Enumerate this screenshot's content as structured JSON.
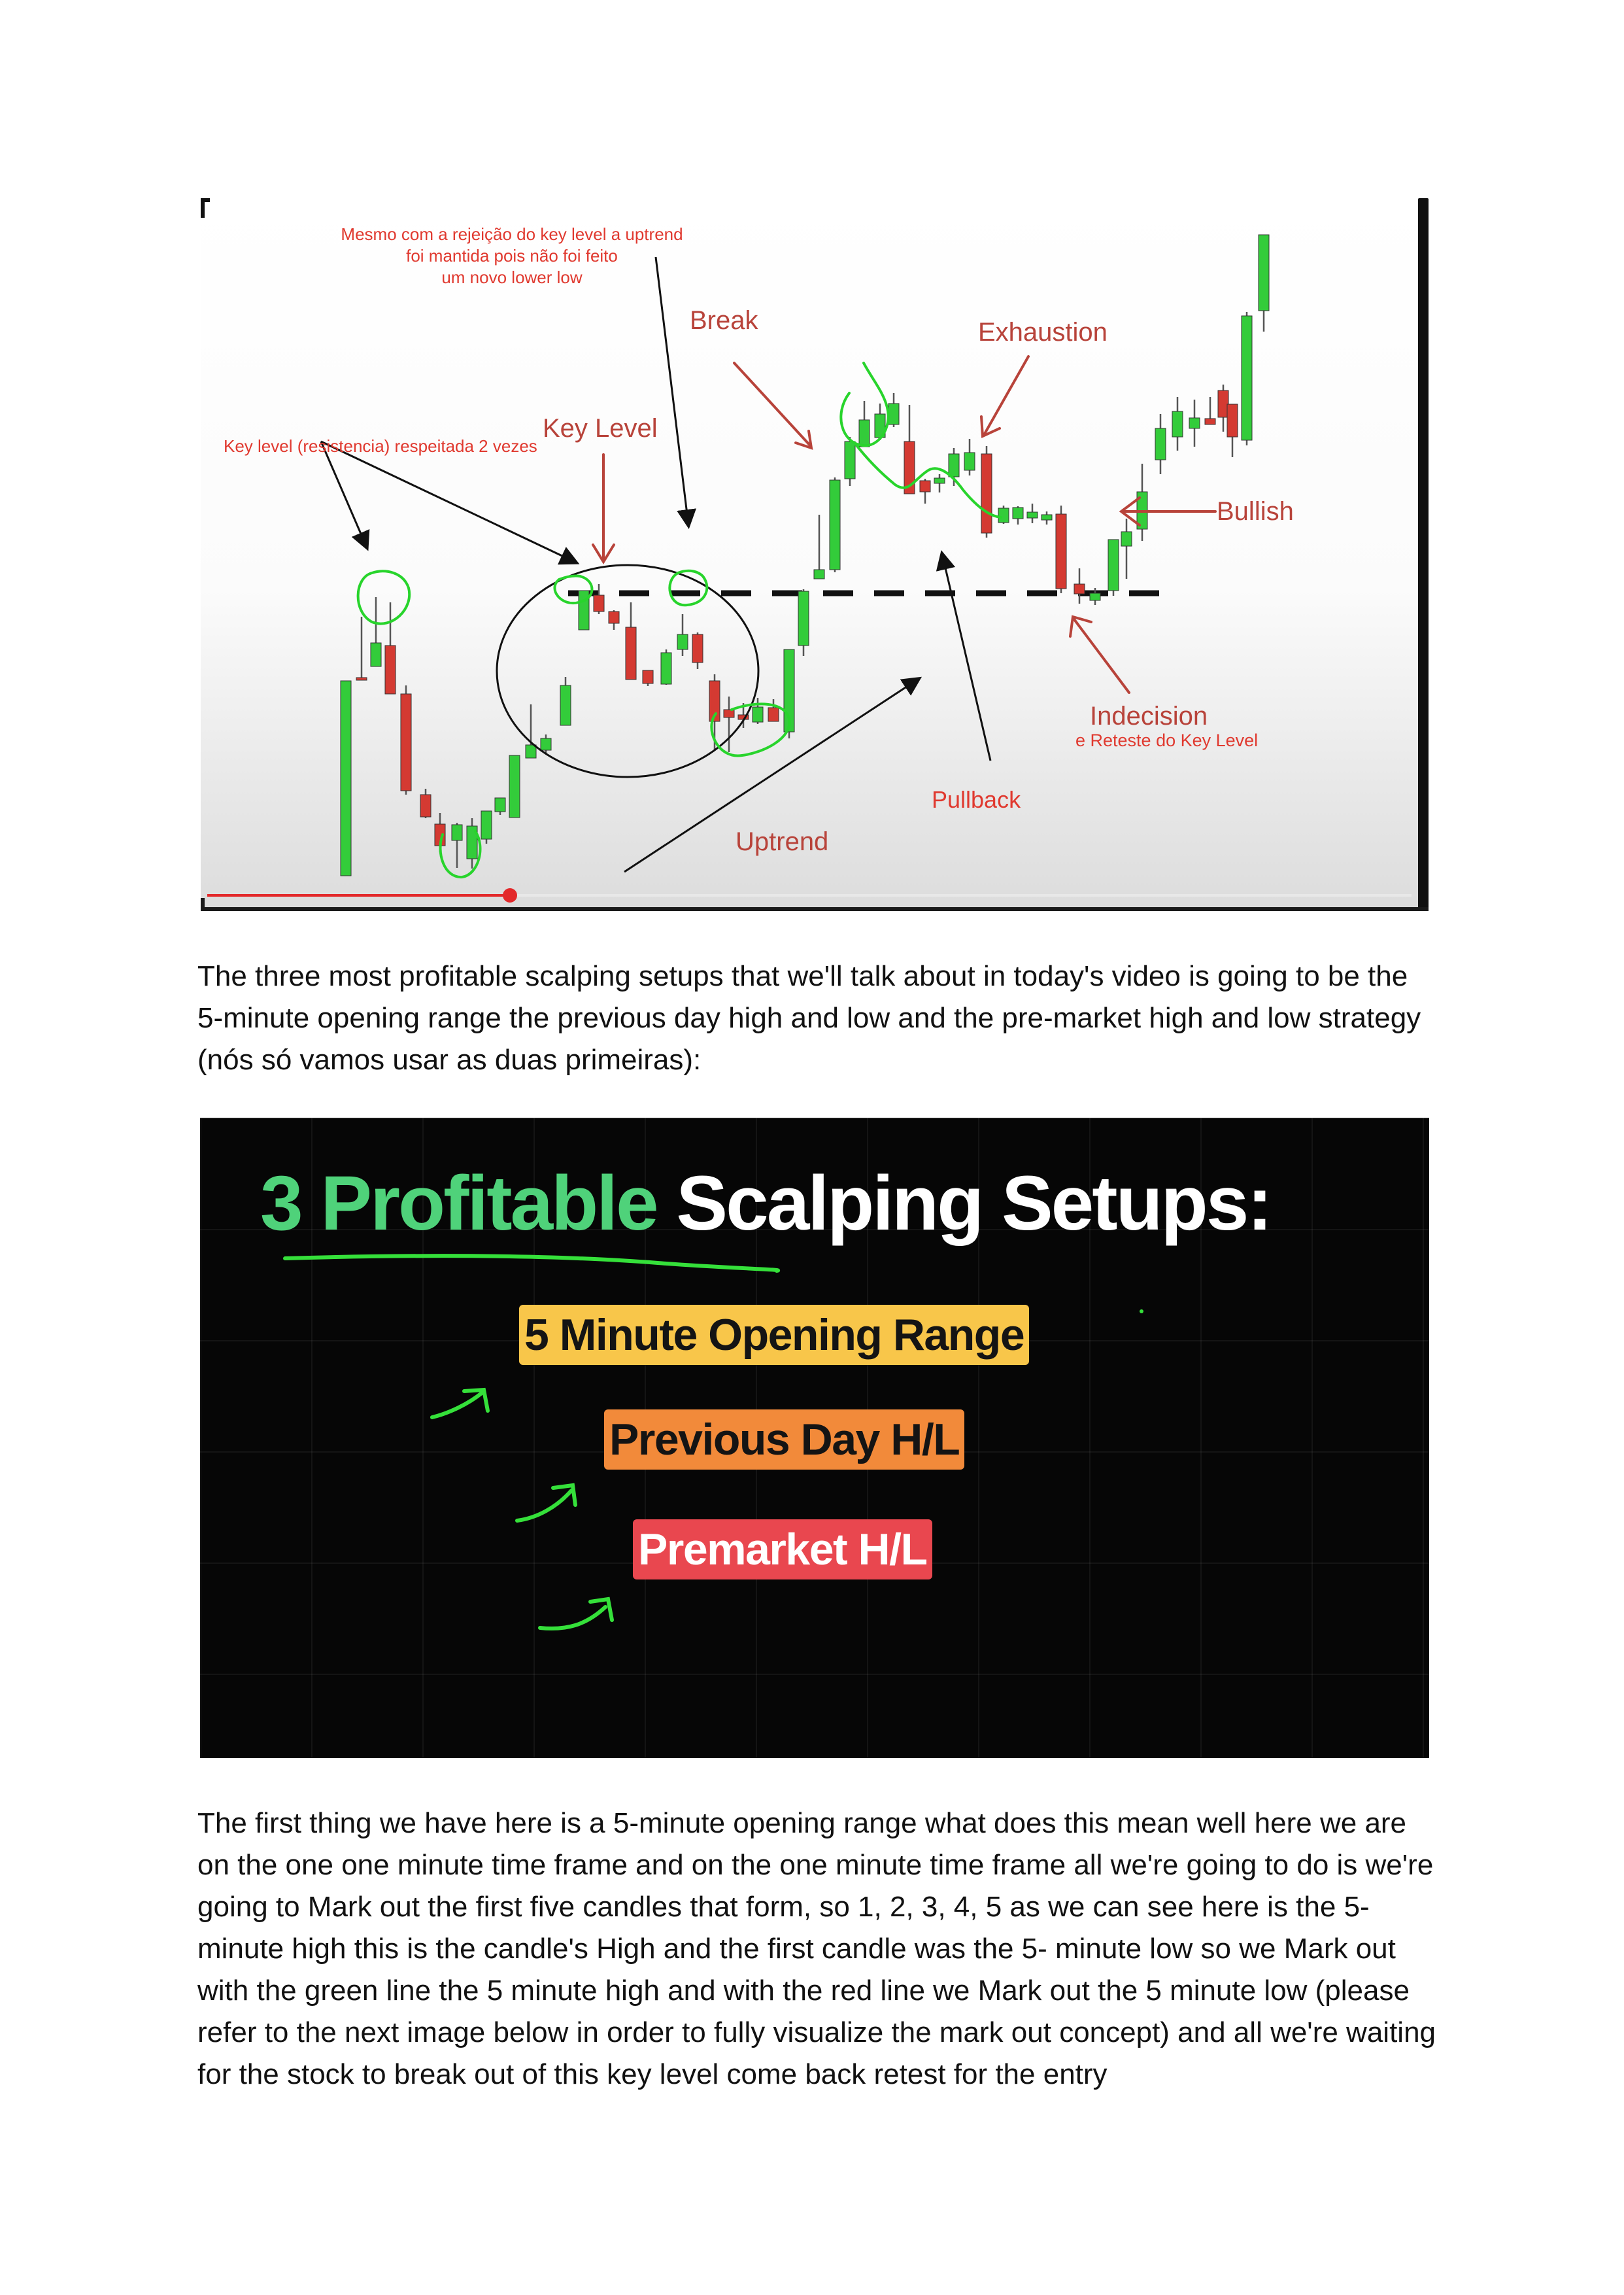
{
  "figure1": {
    "annotations": {
      "top_note_line1": "Mesmo com a rejeição do key level a uptrend",
      "top_note_line2": "foi mantida pois não foi feito",
      "top_note_line3": "um novo lower low",
      "key_level_note": "Key level (resistencia) respeitada 2 vezes",
      "key_level": "Key Level",
      "break": "Break",
      "exhaustion": "Exhaustion",
      "bullish": "Bullish",
      "indecision": "Indecision",
      "retest_note": "e Reteste do Key Level",
      "pullback": "Pullback",
      "uptrend": "Uptrend"
    },
    "colors": {
      "bull": "#33cc3a",
      "bear": "#d43a32",
      "annotation_dark_red": "#b8433a",
      "annotation_red": "#e0392f",
      "highlight_green": "#28d42c"
    }
  },
  "paragraph1": "The three most profitable scalping setups that we'll talk about in today's video is going to be the 5-minute opening range the previous day high and low and the pre-market high and low strategy (nós só vamos usar as duas primeiras):",
  "figure2": {
    "title_green": "3 Profitable",
    "title_white": "Scalping Setups:",
    "items": [
      {
        "label": "5 Minute Opening Range",
        "color": "#f8c64a"
      },
      {
        "label": "Previous Day H/L",
        "color": "#f28a3a"
      },
      {
        "label": "Premarket H/L",
        "color": "#e9474f"
      }
    ],
    "accent": "#35e03a"
  },
  "paragraph2": "The first thing we have here is a 5-minute opening range what does this mean well here we are on the one one minute time frame and on the one minute time frame all we're going to do is we're going to Mark out the first five candles that form, so 1, 2, 3, 4, 5 as we can see here is the 5-minute high this is the candle's High and the first candle was the 5- minute low so we Mark out with the green line the 5 minute high and with the red line we Mark out the 5 minute low (please refer to the next image below in order to fully visualize the mark out concept) and all we're waiting for the stock to break out of this key level come back retest for the entry"
}
